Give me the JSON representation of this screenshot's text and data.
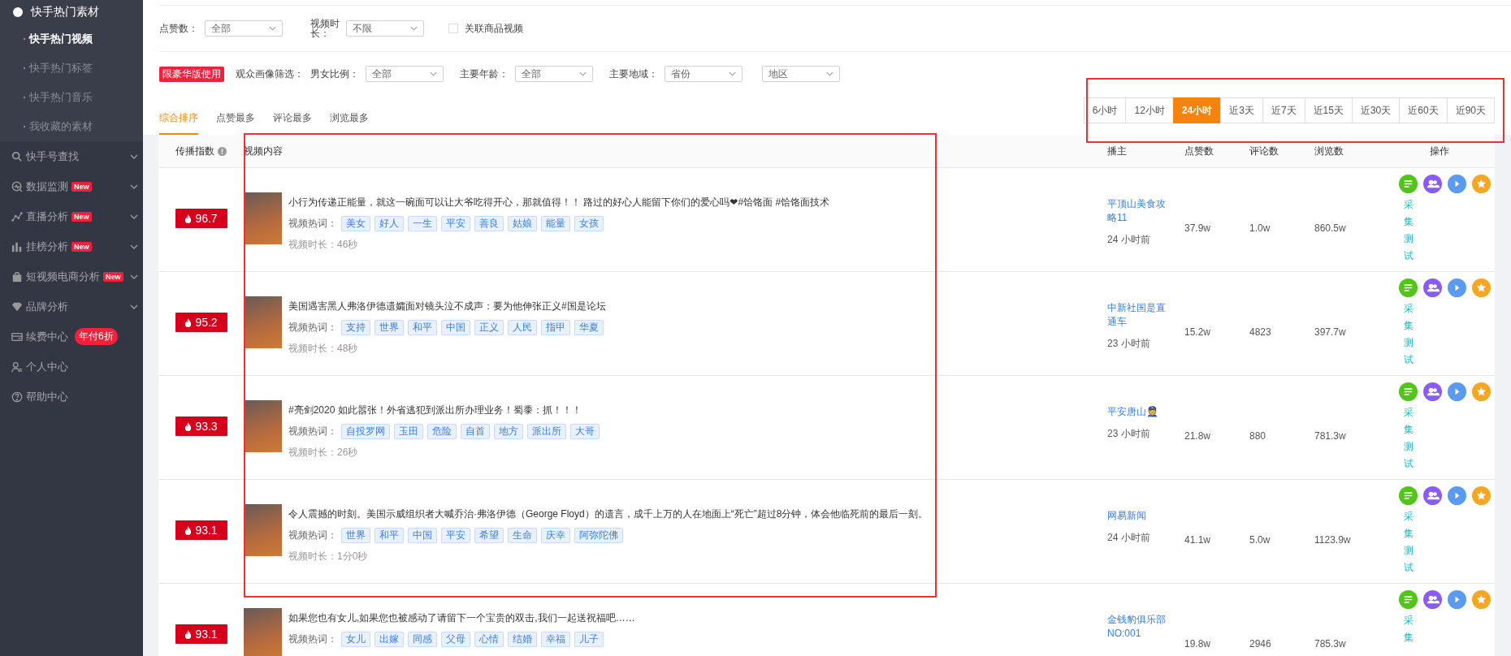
{
  "sidebar": {
    "group": {
      "label": "快手热门素材",
      "children": [
        {
          "label": "快手热门视频",
          "selected": true
        },
        {
          "label": "快手热门标签",
          "selected": false
        },
        {
          "label": "快手热门音乐",
          "selected": false
        },
        {
          "label": "我收藏的素材",
          "selected": false
        }
      ]
    },
    "items": [
      {
        "label": "快手号查找",
        "expandable": true
      },
      {
        "label": "数据监测",
        "badge": "New",
        "expandable": true
      },
      {
        "label": "直播分析",
        "badge": "New",
        "expandable": true
      },
      {
        "label": "挂榜分析",
        "badge": "New",
        "expandable": true
      },
      {
        "label": "短视频电商分析",
        "badge": "New",
        "expandable": true
      },
      {
        "label": "品牌分析",
        "expandable": true
      },
      {
        "label": "续费中心",
        "promo": "年付6折",
        "expandable": false
      },
      {
        "label": "个人中心",
        "expandable": false
      },
      {
        "label": "帮助中心",
        "expandable": false
      }
    ]
  },
  "filters": {
    "likes": {
      "label": "点赞数：",
      "value": "全部"
    },
    "duration": {
      "label": "视频时长：",
      "value": "不限"
    },
    "linked_goods": {
      "label": "关联商品视频",
      "checked": false
    }
  },
  "audience": {
    "badge": "限豪华版使用",
    "title": "观众画像筛选：",
    "selects": [
      {
        "label": "男女比例：",
        "value": "全部"
      },
      {
        "label": "主要年龄：",
        "value": "全部"
      },
      {
        "label": "主要地域：",
        "value": "省份"
      },
      {
        "value": "地区"
      }
    ]
  },
  "sort_tabs": [
    {
      "label": "综合排序",
      "selected": true
    },
    {
      "label": "点赞最多",
      "selected": false
    },
    {
      "label": "评论最多",
      "selected": false
    },
    {
      "label": "浏览最多",
      "selected": false
    }
  ],
  "time_ranges": [
    {
      "label": "6小时",
      "selected": false
    },
    {
      "label": "12小时",
      "selected": false
    },
    {
      "label": "24小时",
      "selected": true
    },
    {
      "label": "近3天",
      "selected": false
    },
    {
      "label": "近7天",
      "selected": false
    },
    {
      "label": "近15天",
      "selected": false
    },
    {
      "label": "近30天",
      "selected": false
    },
    {
      "label": "近60天",
      "selected": false
    },
    {
      "label": "近90天",
      "selected": false
    }
  ],
  "table": {
    "columns": [
      "传播指数",
      "视频内容",
      "播主",
      "点赞数",
      "评论数",
      "浏览数",
      "操作"
    ],
    "rows": [
      {
        "hot_label": "视频热词：",
        "score": "96.7",
        "title": "小行为传递正能量，就这一碗面可以让大爷吃得开心，那就值得！！ 路过的好心人能留下你们的爱心吗❤#饸饹面 #饸饹面技术",
        "tags": [
          "美女",
          "好人",
          "一生",
          "平安",
          "善良",
          "姑娘",
          "能量",
          "女孩"
        ],
        "duration": "视频时长：46秒",
        "anchor": "平顶山美食攻略11",
        "time": "24 小时前",
        "likes": "37.9w",
        "comments": "1.0w",
        "views": "860.5w",
        "action": "采集测试"
      },
      {
        "hot_label": "视频热词：",
        "score": "95.2",
        "title": "美国遇害黑人弗洛伊德遗孀面对镜头泣不成声：要为他伸张正义#国是论坛",
        "tags": [
          "支持",
          "世界",
          "和平",
          "中国",
          "正义",
          "人民",
          "指甲",
          "华夏"
        ],
        "duration": "视频时长：48秒",
        "anchor": "中新社国是直通车",
        "time": "23 小时前",
        "likes": "15.2w",
        "comments": "4823",
        "views": "397.7w",
        "action": "采集测试"
      },
      {
        "hot_label": "视频热词：",
        "score": "93.3",
        "title": "#亮剑2020 如此嚣张！外省逃犯到派出所办理业务！蜀黍：抓！！！",
        "tags": [
          "自投罗网",
          "玉田",
          "危险",
          "自首",
          "地方",
          "派出所",
          "大哥"
        ],
        "duration": "视频时长：26秒",
        "anchor": "平安唐山👮",
        "time": "23 小时前",
        "likes": "21.8w",
        "comments": "880",
        "views": "781.3w",
        "action": "采集测试"
      },
      {
        "hot_label": "视频热词：",
        "score": "93.1",
        "title": "令人震撼的时刻。美国示威组织者大喊乔治·弗洛伊德（George Floyd）的遗言，成千上万的人在地面上“死亡”超过8分钟，体会他临死前的最后一刻。",
        "tags": [
          "世界",
          "和平",
          "中国",
          "平安",
          "希望",
          "生命",
          "庆幸",
          "阿弥陀佛"
        ],
        "duration": "视频时长：1分0秒",
        "anchor": "网易新闻",
        "time": "24 小时前",
        "likes": "41.1w",
        "comments": "5.0w",
        "views": "1123.9w",
        "action": "采集测试"
      },
      {
        "hot_label": "视频热词：",
        "score": "93.1",
        "title": "如果您也有女儿,如果您也被感动了请留下一个宝贵的双击,我们一起送祝福吧……",
        "tags": [
          "女儿",
          "出嫁",
          "同感",
          "父母",
          "心情",
          "结婚",
          "幸福",
          "儿子"
        ],
        "anchor": "金钱豹俱乐部NO:001",
        "likes": "19.8w",
        "comments": "2946",
        "views": "785.3w",
        "action": "采集"
      }
    ]
  }
}
